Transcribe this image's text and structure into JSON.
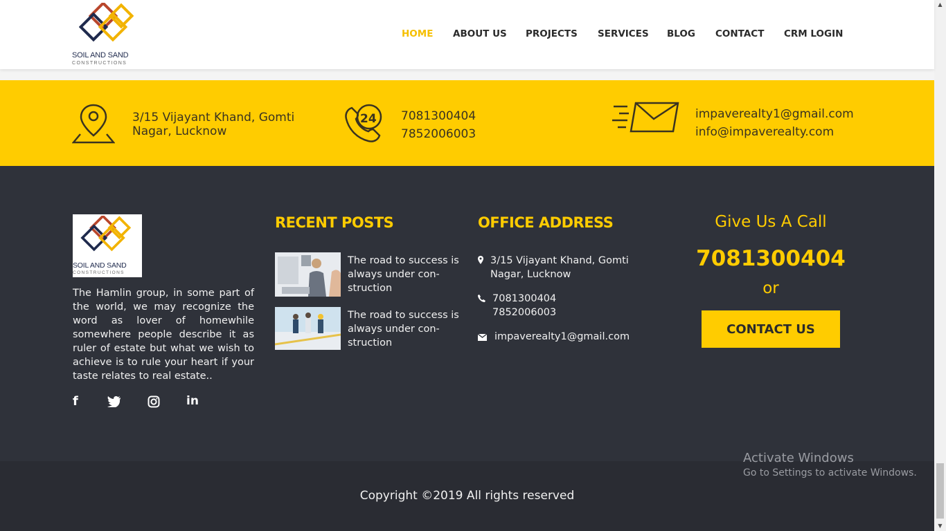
{
  "brand": {
    "name": "SOIL AND SAND",
    "sub": "CONSTRUCTIONS"
  },
  "nav": [
    {
      "label": "HOME",
      "active": true
    },
    {
      "label": "ABOUT US"
    },
    {
      "label": "PROJECTS"
    },
    {
      "label": "SERVICES"
    },
    {
      "label": "BLOG"
    },
    {
      "label": "CONTACT"
    },
    {
      "label": "CRM LOGIN"
    }
  ],
  "infobar": {
    "address": "3/15 Vijayant Khand, Gomti Nagar, Lucknow",
    "phone_badge": "24",
    "phone1": "7081300404",
    "phone2": "7852006003",
    "email1": "impaverealty1@gmail.com",
    "email2": "info@impaverealty.com"
  },
  "footer": {
    "about": "The Hamlin group, in some part of the world, we may recognize the word as lover of homewhile somewhere people describe it as ruler of estate but what we wish to achieve is to rule your heart if your taste relates to real estate..",
    "social": [
      "facebook-icon",
      "twitter-icon",
      "instagram-icon",
      "linkedin-icon"
    ],
    "recent_posts": {
      "heading": "RECENT POSTS",
      "posts": [
        {
          "title": "The road to success is always under con- struction"
        },
        {
          "title": "The road to success is always under con- struction"
        }
      ]
    },
    "office": {
      "heading": "OFFICE ADDRESS",
      "address": "3/15 Vijayant Khand, Gomti Nagar, Lucknow",
      "phone1": "7081300404",
      "phone2": "7852006003",
      "email": "impaverealty1@gmail.com"
    },
    "call": {
      "title": "Give Us A Call",
      "number": "7081300404",
      "or": "or",
      "button": "CONTACT US"
    }
  },
  "copyright": "Copyright ©2019 All rights reserved",
  "watermark": {
    "line1": "Activate Windows",
    "line2": "Go to Settings to activate Windows."
  },
  "colors": {
    "accent": "#ffcc00",
    "dark": "#2f323a",
    "navy": "#1f2a4d"
  }
}
